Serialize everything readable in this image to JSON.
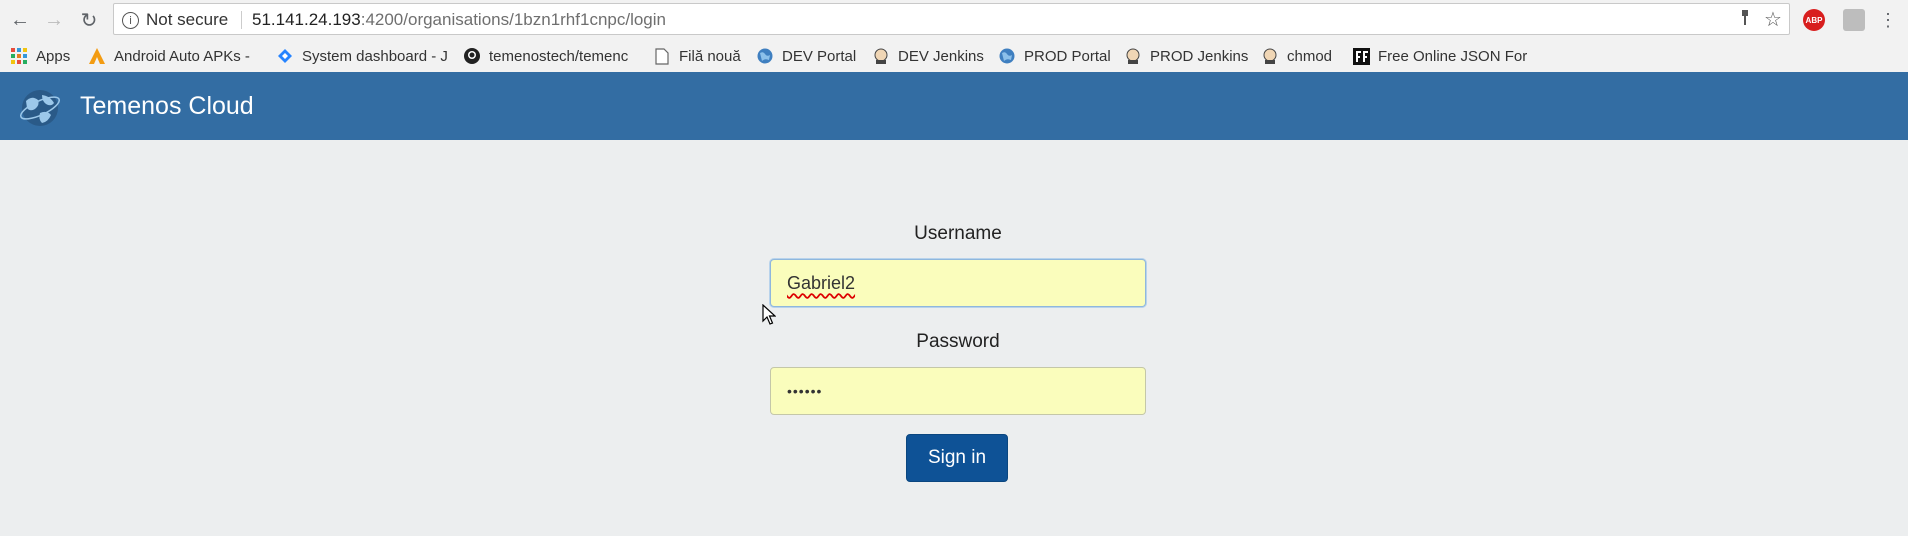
{
  "browser": {
    "security_label": "Not secure",
    "url_host": "51.141.24.193",
    "url_rest": ":4200/organisations/1bzn1rhf1cnpc/login",
    "adblock_label": "ABP"
  },
  "bookmarks": [
    {
      "label": "Apps",
      "icon": "apps-grid-icon"
    },
    {
      "label": "Android Auto APKs -",
      "icon": "android-auto-icon"
    },
    {
      "label": "System dashboard - J",
      "icon": "jira-icon"
    },
    {
      "label": "temenostech/temenc",
      "icon": "github-icon"
    },
    {
      "label": "Filă nouă",
      "icon": "page-icon"
    },
    {
      "label": "DEV Portal",
      "icon": "globe-icon"
    },
    {
      "label": "DEV Jenkins",
      "icon": "jenkins-icon"
    },
    {
      "label": "PROD Portal",
      "icon": "globe-icon"
    },
    {
      "label": "PROD Jenkins",
      "icon": "jenkins-icon"
    },
    {
      "label": "chmod",
      "icon": "jenkins-icon"
    },
    {
      "label": "Free Online JSON For",
      "icon": "ff-icon"
    }
  ],
  "header": {
    "title": "Temenos Cloud",
    "color": "#336da3"
  },
  "login": {
    "username_label": "Username",
    "username_value": "Gabriel2",
    "password_label": "Password",
    "password_value": "••••••",
    "signin_label": "Sign in",
    "field_bg": "#fafdbc",
    "button_color": "#0e5296"
  }
}
